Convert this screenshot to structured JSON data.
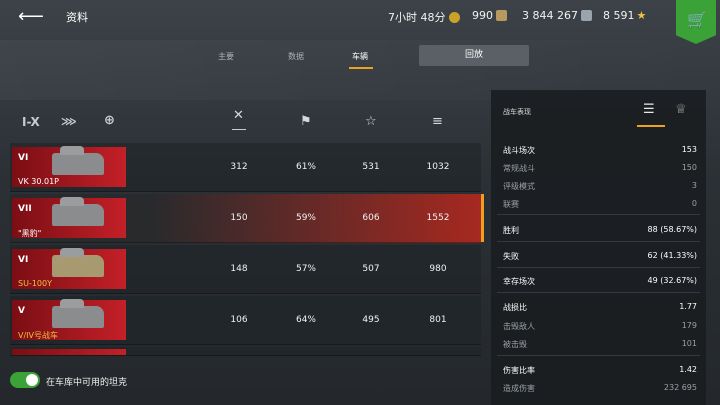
{
  "header": {
    "title": "资料",
    "timer": "7小时 48分",
    "gold": "990",
    "silver": "3 844 267",
    "free_xp": "8 591",
    "shop_icon": "cart-icon"
  },
  "tabs": [
    {
      "label": "主要"
    },
    {
      "label": "数据"
    },
    {
      "label": "车辆"
    },
    {
      "label": "回放"
    }
  ],
  "filters": {
    "tier": "I-X",
    "nation_icon": "nation-icon",
    "globe_icon": "globe-icon"
  },
  "columns": [
    {
      "icon": "battles-icon"
    },
    {
      "icon": "victory-flag-icon"
    },
    {
      "icon": "mastery-star-icon"
    },
    {
      "icon": "damage-icon"
    }
  ],
  "vehicles": [
    {
      "tier": "VI",
      "name": "VK 30.01P",
      "name_color": "white",
      "battles": "312",
      "winrate": "61%",
      "wn": "531",
      "damage": "1032"
    },
    {
      "tier": "VII",
      "name": "\"黑豹\"",
      "name_color": "white",
      "battles": "150",
      "winrate": "59%",
      "wn": "606",
      "damage": "1552"
    },
    {
      "tier": "VI",
      "name": "SU-100Y",
      "name_color": "gold",
      "battles": "148",
      "winrate": "57%",
      "wn": "507",
      "damage": "980"
    },
    {
      "tier": "V",
      "name": "V/IV号战车",
      "name_color": "gold",
      "battles": "106",
      "winrate": "64%",
      "wn": "495",
      "damage": "801"
    }
  ],
  "panel": {
    "title": "战车表现",
    "stats": [
      {
        "label": "战斗场次",
        "value": "153",
        "kind": "main"
      },
      {
        "label": "常规战斗",
        "value": "150",
        "kind": "sub"
      },
      {
        "label": "评级模式",
        "value": "3",
        "kind": "sub"
      },
      {
        "label": "联赛",
        "value": "0",
        "kind": "sub"
      },
      {
        "label": "胜利",
        "value": "88 (58.67%)",
        "kind": "main"
      },
      {
        "label": "失败",
        "value": "62 (41.33%)",
        "kind": "main"
      },
      {
        "label": "幸存场次",
        "value": "49 (32.67%)",
        "kind": "main"
      },
      {
        "label": "战损比",
        "value": "1.77",
        "kind": "main"
      },
      {
        "label": "击毁敌人",
        "value": "179",
        "kind": "sub"
      },
      {
        "label": "被击毁",
        "value": "101",
        "kind": "sub"
      },
      {
        "label": "伤害比率",
        "value": "1.42",
        "kind": "main"
      },
      {
        "label": "造成伤害",
        "value": "232 695",
        "kind": "sub"
      }
    ]
  },
  "toggle": {
    "label": "在车库中可用的坦克",
    "on": true
  },
  "colors": {
    "accent": "#f0a020",
    "green": "#3aa236",
    "red": "#c42028"
  }
}
